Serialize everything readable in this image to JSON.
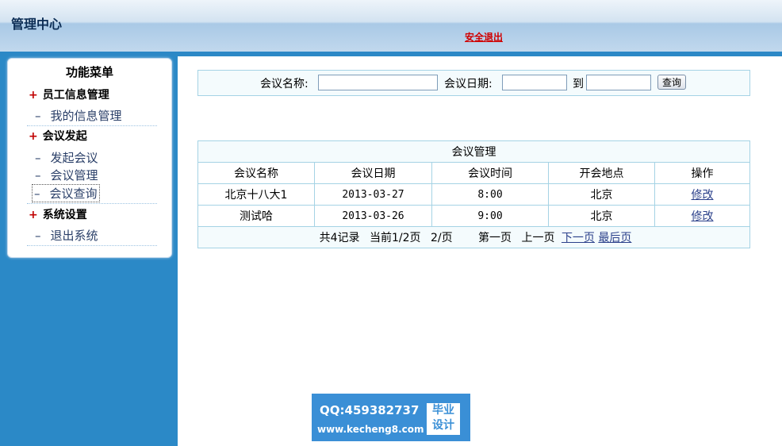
{
  "header": {
    "title": "管理中心",
    "logout": "安全退出"
  },
  "menu": {
    "title": "功能菜单",
    "groups": [
      {
        "label": "员工信息管理",
        "items": [
          "我的信息管理"
        ]
      },
      {
        "label": "会议发起",
        "items": [
          "发起会议",
          "会议管理",
          "会议查询"
        ]
      },
      {
        "label": "系统设置",
        "items": [
          "退出系统"
        ]
      }
    ],
    "plus": "+",
    "dash": "–"
  },
  "search": {
    "name_label": "会议名称:",
    "date_label": "会议日期:",
    "to_label": "到",
    "name_value": "",
    "date_from": "",
    "date_to": "",
    "button": "查询"
  },
  "table": {
    "caption": "会议管理",
    "columns": [
      "会议名称",
      "会议日期",
      "会议时间",
      "开会地点",
      "操作"
    ],
    "rows": [
      {
        "name": "北京十八大1",
        "date": "2013-03-27",
        "time": "8:00",
        "place": "北京",
        "action": "修改"
      },
      {
        "name": "测试哈",
        "date": "2013-03-26",
        "time": "9:00",
        "place": "北京",
        "action": "修改"
      }
    ],
    "pager": {
      "total": "共4记录",
      "current": "当前1/2页",
      "per_page": "2/页",
      "first": "第一页",
      "prev": "上一页",
      "next": "下一页",
      "last": "最后页"
    }
  },
  "watermark": {
    "qq": "QQ:459382737",
    "url": "www.kecheng8.com",
    "seal_line1": "毕业",
    "seal_line2": "设计"
  }
}
